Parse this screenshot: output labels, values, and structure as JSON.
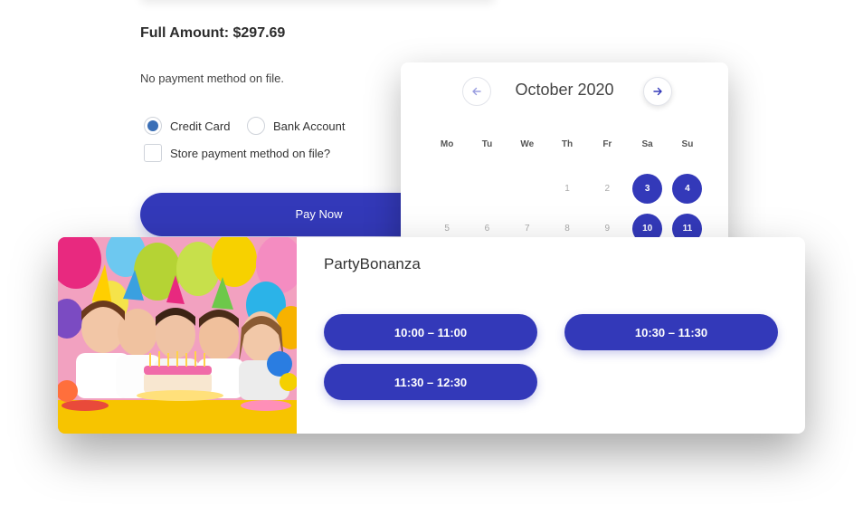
{
  "payment": {
    "full_amount": "Full Amount: $297.69",
    "no_method": "No payment method on file.",
    "options": [
      {
        "label": "Credit Card",
        "checked": true
      },
      {
        "label": "Bank Account",
        "checked": false
      }
    ],
    "store_label": "Store payment method on file?",
    "pay_now": "Pay Now"
  },
  "calendar": {
    "month": "October 2020",
    "prev_icon": "arrow-left-icon",
    "next_icon": "arrow-right-icon",
    "weekdays": [
      "Mo",
      "Tu",
      "We",
      "Th",
      "Fr",
      "Sa",
      "Su"
    ],
    "weeks": [
      [
        {
          "label": "",
          "selected": false
        },
        {
          "label": "",
          "selected": false
        },
        {
          "label": "",
          "selected": false
        },
        {
          "label": "1",
          "selected": false
        },
        {
          "label": "2",
          "selected": false
        },
        {
          "label": "3",
          "selected": true
        },
        {
          "label": "4",
          "selected": true
        }
      ],
      [
        {
          "label": "5",
          "selected": false
        },
        {
          "label": "6",
          "selected": false
        },
        {
          "label": "7",
          "selected": false
        },
        {
          "label": "8",
          "selected": false
        },
        {
          "label": "9",
          "selected": false
        },
        {
          "label": "10",
          "selected": true
        },
        {
          "label": "11",
          "selected": true
        }
      ]
    ]
  },
  "event": {
    "title": "PartyBonanza",
    "photo": "birthday-party-photo",
    "slots": [
      "10:00 – 11:00",
      "10:30 – 11:30",
      "11:30 – 12:30"
    ]
  },
  "colors": {
    "accent": "#3339b9",
    "radio_checked": "#3b6fb6"
  }
}
